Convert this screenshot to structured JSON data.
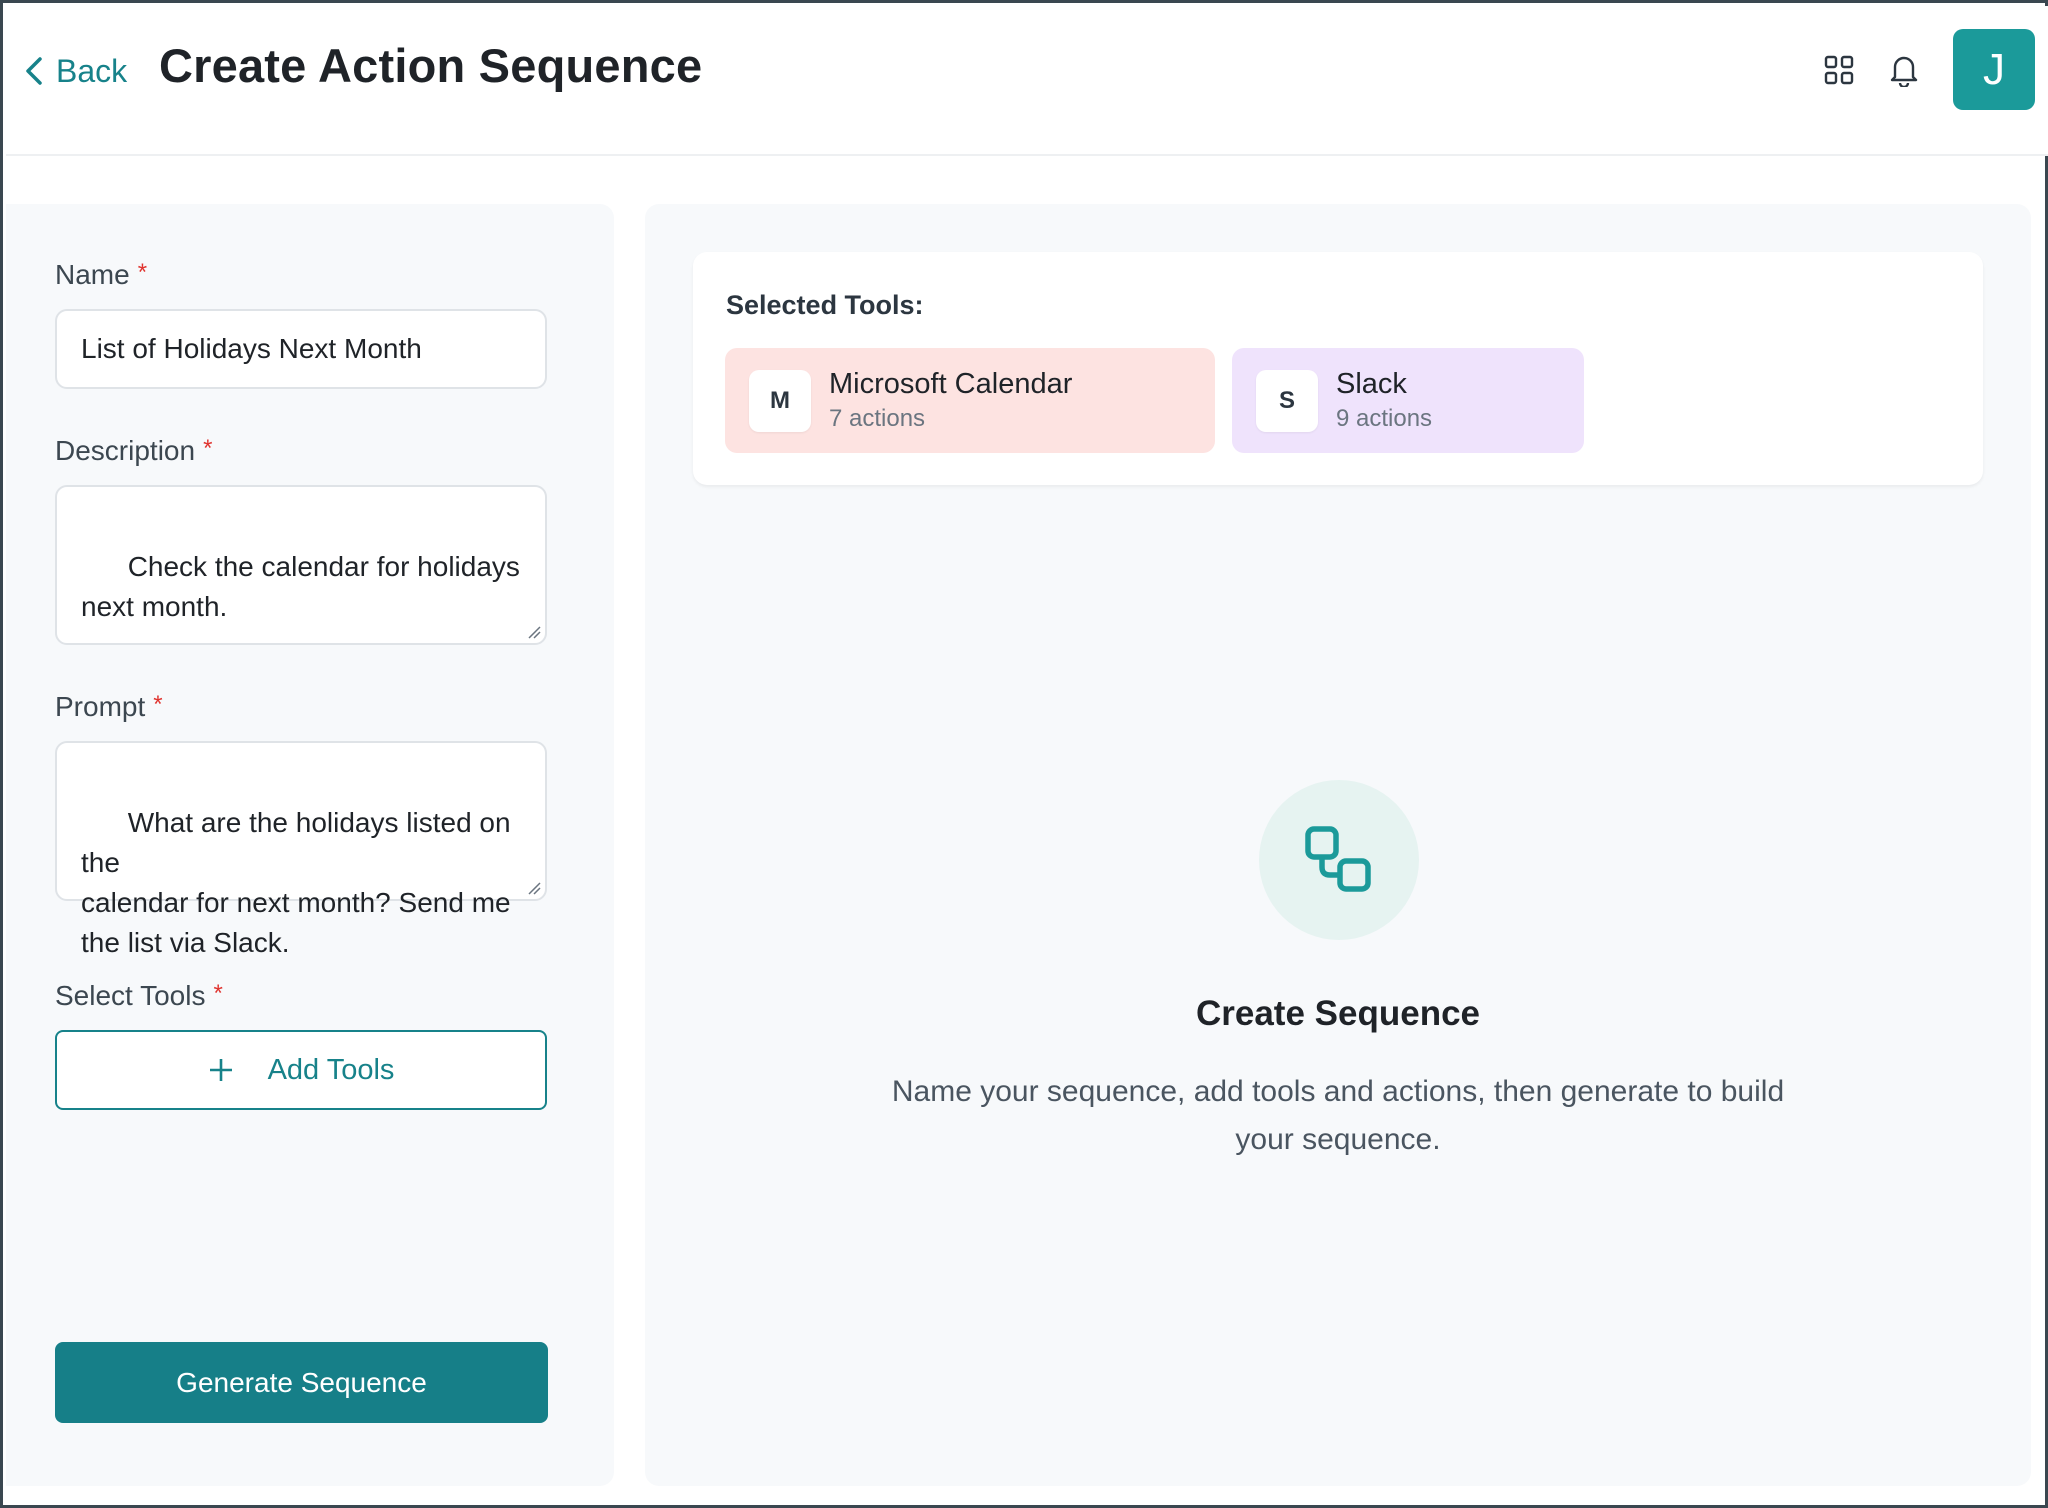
{
  "header": {
    "back_label": "Back",
    "title": "Create Action Sequence",
    "apps_icon": "grid-icon",
    "notifications_icon": "bell-icon",
    "avatar_initial": "J"
  },
  "form": {
    "name": {
      "label": "Name",
      "required_mark": "*",
      "value": "List of Holidays Next Month"
    },
    "description": {
      "label": "Description",
      "required_mark": "*",
      "value": "Check the calendar for holidays\nnext month."
    },
    "prompt": {
      "label": "Prompt",
      "required_mark": "*",
      "value": "What are the holidays listed on the\ncalendar for next month? Send me\nthe list via Slack."
    },
    "select_tools": {
      "label": "Select Tools",
      "required_mark": "*",
      "add_label": "Add Tools",
      "add_icon": "plus-icon"
    },
    "generate_label": "Generate Sequence"
  },
  "selected_tools": {
    "title": "Selected Tools:",
    "items": [
      {
        "letter": "M",
        "name": "Microsoft Calendar",
        "actions": "7 actions",
        "bg": "#fde3e1"
      },
      {
        "letter": "S",
        "name": "Slack",
        "actions": "9 actions",
        "bg": "#efe3fc"
      }
    ]
  },
  "empty_state": {
    "icon": "workflow-icon",
    "title": "Create Sequence",
    "description": "Name your sequence, add tools and actions, then generate to build your sequence."
  },
  "colors": {
    "accent": "#17828a",
    "primary_button": "#167f88",
    "avatar": "#1b9a9a",
    "required": "#e0342f"
  }
}
